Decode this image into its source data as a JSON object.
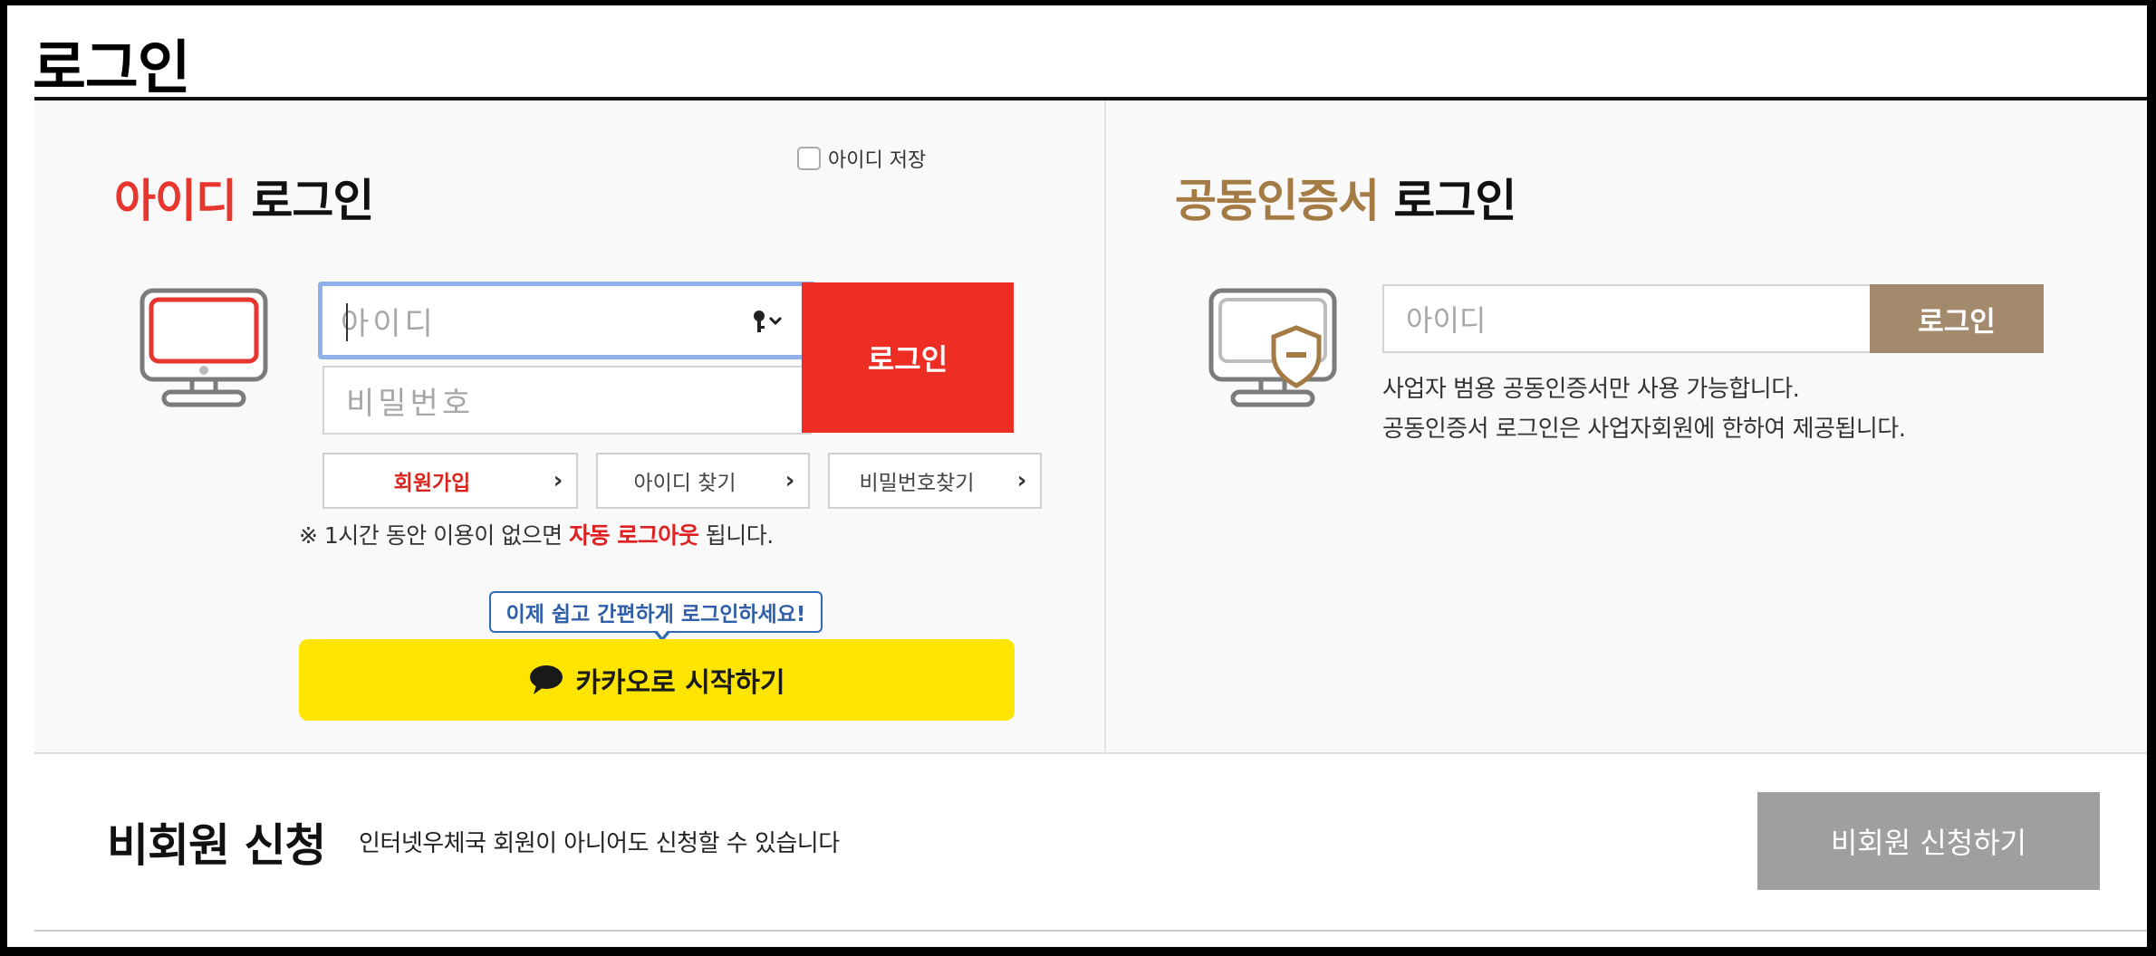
{
  "page": {
    "title": "로그인"
  },
  "id_login": {
    "title_accent": "아이디",
    "title_rest": " 로그인",
    "save_id_label": "아이디 저장",
    "id_placeholder": "아이디",
    "pw_placeholder": "비밀번호",
    "login_button": "로그인",
    "links": {
      "signup": "회원가입",
      "find_id": "아이디 찾기",
      "find_pw": "비밀번호찾기"
    },
    "notice": {
      "prefix": "※ 1시간 동안 이용이 없으면 ",
      "highlight": "자동 로그아웃",
      "suffix": " 됩니다."
    },
    "kakao": {
      "bubble": "이제 쉽고 간편하게 로그인하세요!",
      "button": "카카오로 시작하기"
    }
  },
  "cert_login": {
    "title_accent": "공동인증서",
    "title_rest": " 로그인",
    "id_placeholder": "아이디",
    "login_button": "로그인",
    "info_line1": "사업자 범용 공동인증서만 사용 가능합니다.",
    "info_line2": "공동인증서 로그인은 사업자회원에 한하여 제공됩니다."
  },
  "guest": {
    "title": "비회원 신청",
    "desc": "인터넷우체국 회원이 아니어도 신청할 수 있습니다",
    "button": "비회원 신청하기"
  },
  "colors": {
    "accent_red": "#e8352e",
    "accent_gold": "#a47a45",
    "kakao_yellow": "#fee500",
    "gold_button": "#a38a6c",
    "gray_button": "#9f9f9f"
  }
}
